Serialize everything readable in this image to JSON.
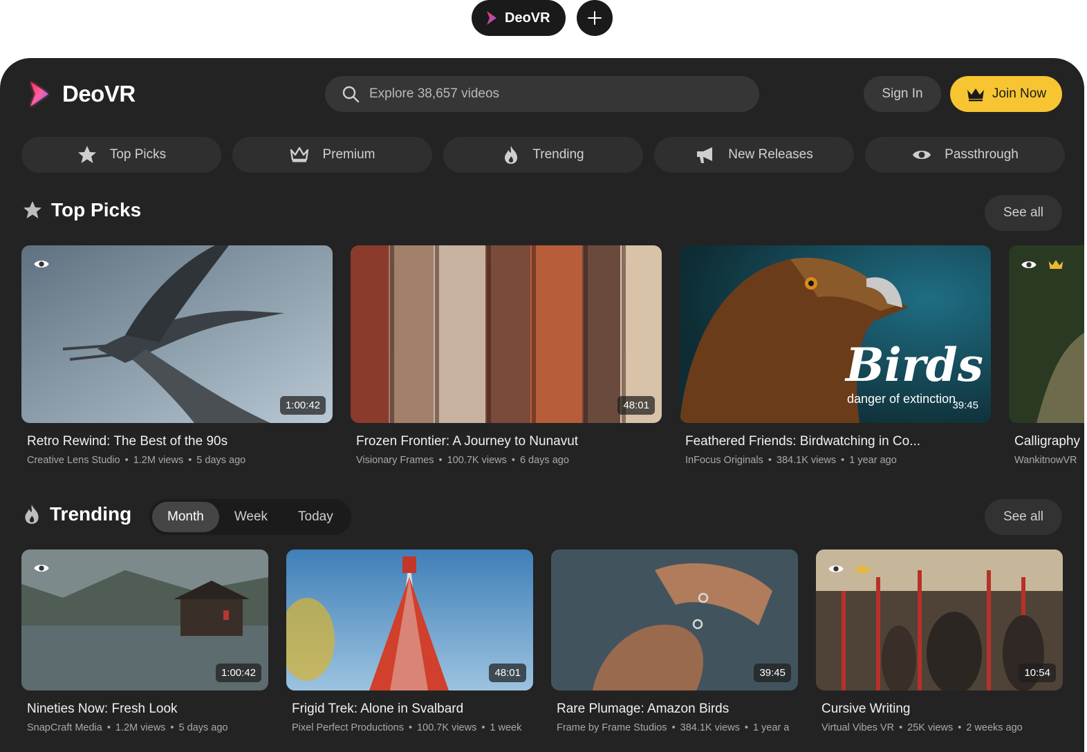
{
  "tabs": {
    "app_tab_label": "DeoVR",
    "add_tab_symbol": "+"
  },
  "header": {
    "brand": "DeoVR",
    "search_placeholder": "Explore 38,657 videos",
    "sign_in": "Sign In",
    "join_now": "Join Now"
  },
  "categories": [
    {
      "label": "Top Picks",
      "icon": "star-icon"
    },
    {
      "label": "Premium",
      "icon": "crown-icon"
    },
    {
      "label": "Trending",
      "icon": "flame-icon"
    },
    {
      "label": "New Releases",
      "icon": "megaphone-icon"
    },
    {
      "label": "Passthrough",
      "icon": "eye-icon"
    }
  ],
  "top_picks": {
    "title": "Top Picks",
    "see_all": "See all",
    "videos": [
      {
        "title": "Retro Rewind: The Best of the 90s",
        "studio": "Creative Lens Studio",
        "views": "1.2M views",
        "age": "5 days ago",
        "duration": "1:00:42"
      },
      {
        "title": "Frozen Frontier: A Journey to Nunavut",
        "studio": "Visionary Frames",
        "views": "100.7K views",
        "age": "6 days ago",
        "duration": "48:01"
      },
      {
        "title": "Feathered Friends: Birdwatching in Co...",
        "studio": "InFocus Originals",
        "views": "384.1K views",
        "age": "1 year ago",
        "duration": "39:45",
        "overlay_title": "Birds",
        "overlay_subtitle": "danger of extinction"
      },
      {
        "title": "Calligraphy",
        "studio": "WankitnowVR"
      }
    ]
  },
  "trending": {
    "title": "Trending",
    "see_all": "See all",
    "filters": [
      "Month",
      "Week",
      "Today"
    ],
    "active_filter": "Month",
    "videos": [
      {
        "title": "Nineties Now: Fresh Look",
        "studio": "SnapCraft Media",
        "views": "1.2M views",
        "age": "5 days ago",
        "duration": "1:00:42"
      },
      {
        "title": "Frigid Trek: Alone in Svalbard",
        "studio": "Pixel Perfect Productions",
        "views": "100.7K views",
        "age": "1 week",
        "duration": "48:01"
      },
      {
        "title": "Rare Plumage: Amazon Birds",
        "studio": "Frame by Frame Studios",
        "views": "384.1K views",
        "age": "1 year a",
        "duration": "39:45"
      },
      {
        "title": "Cursive Writing",
        "studio": "Virtual Vibes VR",
        "views": "25K views",
        "age": "2 weeks ago",
        "duration": "10:54"
      }
    ]
  },
  "colors": {
    "background": "#232323",
    "accent": "#f7c531",
    "pill": "#363636"
  }
}
